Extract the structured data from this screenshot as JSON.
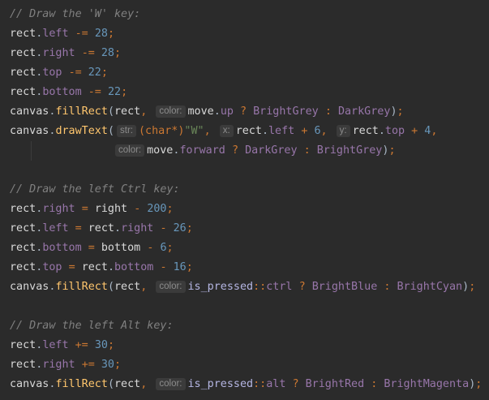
{
  "lines": {
    "c1": "// Draw the 'W' key:",
    "l2": {
      "obj": "rect",
      "field": "left",
      "op": "-=",
      "num": "28"
    },
    "l3": {
      "obj": "rect",
      "field": "right",
      "op": "-=",
      "num": "28"
    },
    "l4": {
      "obj": "rect",
      "field": "top",
      "op": "-=",
      "num": "22"
    },
    "l5": {
      "obj": "rect",
      "field": "bottom",
      "op": "-=",
      "num": "22"
    },
    "l6": {
      "obj": "canvas",
      "func": "fillRect",
      "arg1": "rect",
      "hint": "color:",
      "a": "move",
      "b": "up",
      "c1": "BrightGrey",
      "c2": "DarkGrey"
    },
    "l7": {
      "obj": "canvas",
      "func": "drawText",
      "hint_str": "str:",
      "cast": "(char*)",
      "str": "\"W\"",
      "hint_x": "x:",
      "x_field": "left",
      "x_num": "6",
      "hint_y": "y:",
      "y_field": "top",
      "y_num": "4"
    },
    "l8": {
      "hint": "color:",
      "a": "move",
      "b": "forward",
      "c1": "DarkGrey",
      "c2": "BrightGrey"
    },
    "c2": "// Draw the left Ctrl key:",
    "l10": {
      "field": "right",
      "rhs": "right",
      "num": "200"
    },
    "l11": {
      "field": "left",
      "rhs_obj": "rect",
      "rhs_field": "right",
      "num": "26"
    },
    "l12": {
      "field": "bottom",
      "rhs": "bottom",
      "num": "6"
    },
    "l13": {
      "field": "top",
      "rhs_obj": "rect",
      "rhs_field": "bottom",
      "num": "16"
    },
    "l14": {
      "hint": "color:",
      "ns": "is_pressed",
      "m": "ctrl",
      "c1": "BrightBlue",
      "c2": "BrightCyan"
    },
    "c3": "// Draw the left Alt key:",
    "l16": {
      "field": "left",
      "op": "+=",
      "num": "30"
    },
    "l17": {
      "field": "right",
      "op": "+=",
      "num": "30"
    },
    "l18": {
      "hint": "color:",
      "ns": "is_pressed",
      "m": "alt",
      "c1": "BrightRed",
      "c2": "BrightMagenta"
    }
  }
}
